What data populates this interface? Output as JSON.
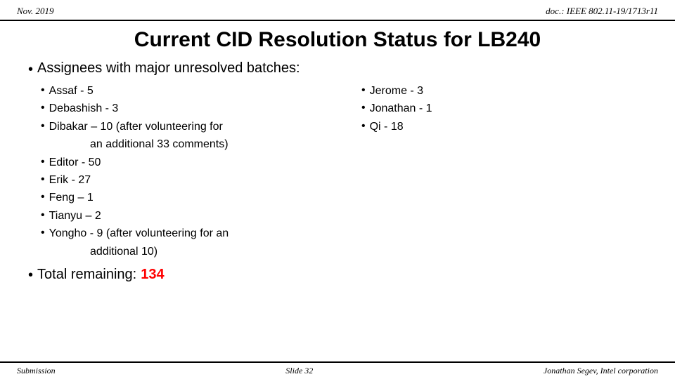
{
  "header": {
    "left": "Nov. 2019",
    "right": "doc.: IEEE 802.11-19/1713r11"
  },
  "title": "Current CID Resolution Status for LB240",
  "main_bullets": [
    {
      "text": "Assignees with major unresolved batches:"
    }
  ],
  "left_column": [
    {
      "text": "Assaf - 5"
    },
    {
      "text": "Debashish - 3"
    },
    {
      "text": "Dibakar – ",
      "extra": "10 (after volunteering for",
      "indent": "an additional 33 comments)"
    },
    {
      "text": "Editor - 50"
    },
    {
      "text": "Erik - 27"
    },
    {
      "text": "Feng – 1"
    },
    {
      "text": "Tianyu – 2"
    },
    {
      "text": "Yongho - 9 (after volunteering for an",
      "indent": "additional 10)"
    }
  ],
  "right_column": [
    {
      "text": "Jerome - 3"
    },
    {
      "text": "Jonathan - 1"
    },
    {
      "text": "Qi - 18"
    }
  ],
  "total": {
    "label": "Total remaining: ",
    "number": "134"
  },
  "footer": {
    "left": "Submission",
    "center": "Slide 32",
    "right": "Jonathan Segev, Intel corporation"
  }
}
